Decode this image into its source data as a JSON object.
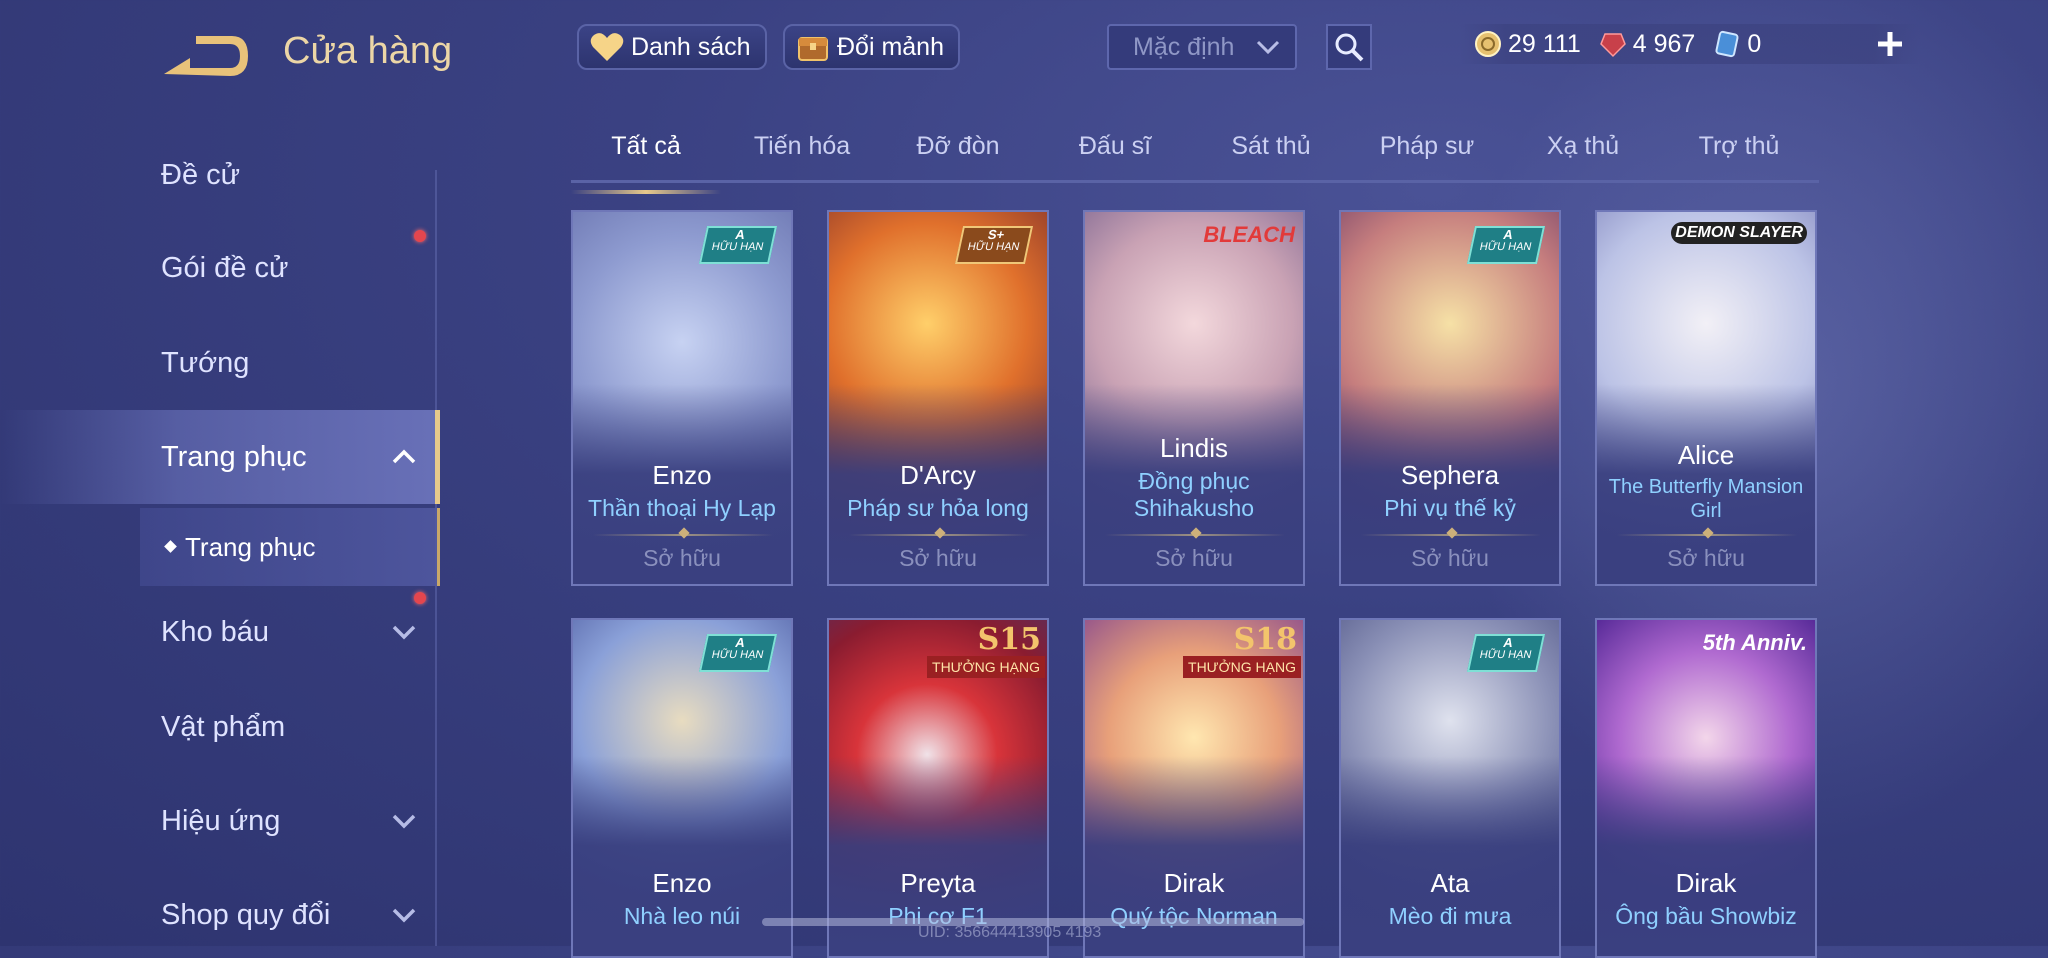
{
  "header": {
    "title": "Cửa hàng",
    "list_button": "Danh sách",
    "exchange_button": "Đổi mảnh",
    "sort_value": "Mặc định"
  },
  "currencies": [
    {
      "icon": "gold-coin-icon",
      "value": "29 111"
    },
    {
      "icon": "red-gem-icon",
      "value": "4 967"
    },
    {
      "icon": "voucher-icon",
      "value": "0"
    }
  ],
  "sidebar": {
    "items": [
      {
        "label": "Đề cử"
      },
      {
        "label": "Gói đề cử"
      },
      {
        "label": "Tướng"
      },
      {
        "label": "Trang phục"
      },
      {
        "label": "Kho báu"
      },
      {
        "label": "Vật phẩm"
      },
      {
        "label": "Hiệu ứng"
      },
      {
        "label": "Shop quy đổi"
      }
    ],
    "sub_item": "Trang phục"
  },
  "tabs": [
    "Tất cả",
    "Tiến hóa",
    "Đỡ đòn",
    "Đấu sĩ",
    "Sát thủ",
    "Pháp sư",
    "Xạ thủ",
    "Trợ thủ"
  ],
  "owned_label": "Sở hữu",
  "cards": [
    {
      "hero": "Enzo",
      "skin": "Thần thoại Hy Lạp",
      "badge": "A",
      "badge_sub": "HỮU HẠN",
      "owned": true
    },
    {
      "hero": "D'Arcy",
      "skin": "Pháp sư hỏa long",
      "badge": "S+",
      "badge_sub": "HỮU HẠN",
      "owned": true
    },
    {
      "hero": "Lindis",
      "skin": "Đồng phục Shihakusho",
      "logo": "BLEACH",
      "owned": true
    },
    {
      "hero": "Sephera",
      "skin": "Phi vụ thế kỷ",
      "badge": "A",
      "badge_sub": "HỮU HẠN",
      "owned": true
    },
    {
      "hero": "Alice",
      "skin": "The Butterfly Mansion Girl",
      "logo": "DEMON SLAYER",
      "owned": true
    },
    {
      "hero": "Enzo",
      "skin": "Nhà leo núi",
      "badge": "A",
      "badge_sub": "HỮU HẠN"
    },
    {
      "hero": "Preyta",
      "skin": "Phi cơ F1",
      "season": "S15",
      "ribbon": "THƯỞNG HẠNG"
    },
    {
      "hero": "Dirak",
      "skin": "Quý tộc Norman",
      "season": "S18",
      "ribbon": "THƯỞNG HẠNG"
    },
    {
      "hero": "Ata",
      "skin": "Mèo đi mưa",
      "badge": "A",
      "badge_sub": "HỮU HẠN"
    },
    {
      "hero": "Dirak",
      "skin": "Ông bầu Showbiz",
      "logo": "5th Anniv."
    }
  ],
  "uid_text": "UID: 356644413905 4193",
  "colors": {
    "accent_gold": "#e7c98b",
    "skin_name": "#8fd0ff",
    "notification": "#e3464e"
  }
}
